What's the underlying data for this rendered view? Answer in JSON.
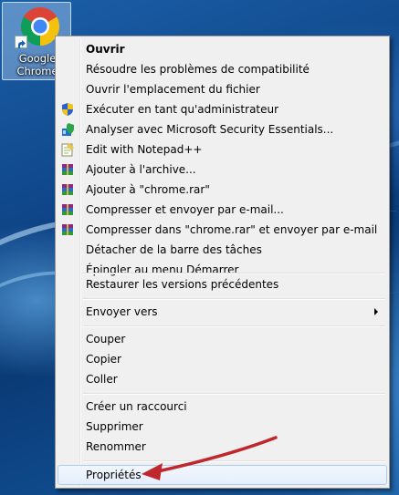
{
  "desktop": {
    "icon": {
      "label_line1": "Google",
      "label_line2": "Chrome"
    }
  },
  "context_menu": {
    "items": [
      {
        "label": "Ouvrir",
        "bold": true,
        "icon": ""
      },
      {
        "label": "Résoudre les problèmes de compatibilité",
        "icon": ""
      },
      {
        "label": "Ouvrir l'emplacement du fichier",
        "icon": ""
      },
      {
        "label": "Exécuter en tant qu'administrateur",
        "icon": "uac-shield-icon"
      },
      {
        "label": "Analyser avec Microsoft Security Essentials...",
        "icon": "security-essentials-icon"
      },
      {
        "label": "Edit with Notepad++",
        "icon": "notepad-plus-plus-icon"
      },
      {
        "label": "Ajouter à l'archive...",
        "icon": "winrar-icon"
      },
      {
        "label": "Ajouter à \"chrome.rar\"",
        "icon": "winrar-icon"
      },
      {
        "label": "Compresser et envoyer par e-mail...",
        "icon": "winrar-icon"
      },
      {
        "label": "Compresser dans \"chrome.rar\" et envoyer par e-mail",
        "icon": "winrar-icon"
      },
      {
        "label": "Détacher de la barre des tâches",
        "icon": ""
      },
      {
        "label": "Épingler au menu Démarrer",
        "icon": ""
      },
      {
        "label": "Restaurer les versions précédentes",
        "icon": ""
      },
      {
        "label": "Envoyer vers",
        "icon": "",
        "submenu": true
      },
      {
        "label": "Couper",
        "icon": ""
      },
      {
        "label": "Copier",
        "icon": ""
      },
      {
        "label": "Coller",
        "icon": ""
      },
      {
        "label": "Créer un raccourci",
        "icon": ""
      },
      {
        "label": "Supprimer",
        "icon": ""
      },
      {
        "label": "Renommer",
        "icon": ""
      },
      {
        "label": "Propriétés",
        "icon": "",
        "highlighted": true
      }
    ]
  },
  "annotation": {
    "arrow_color": "#c0272d",
    "points_to": "Propriétés"
  }
}
